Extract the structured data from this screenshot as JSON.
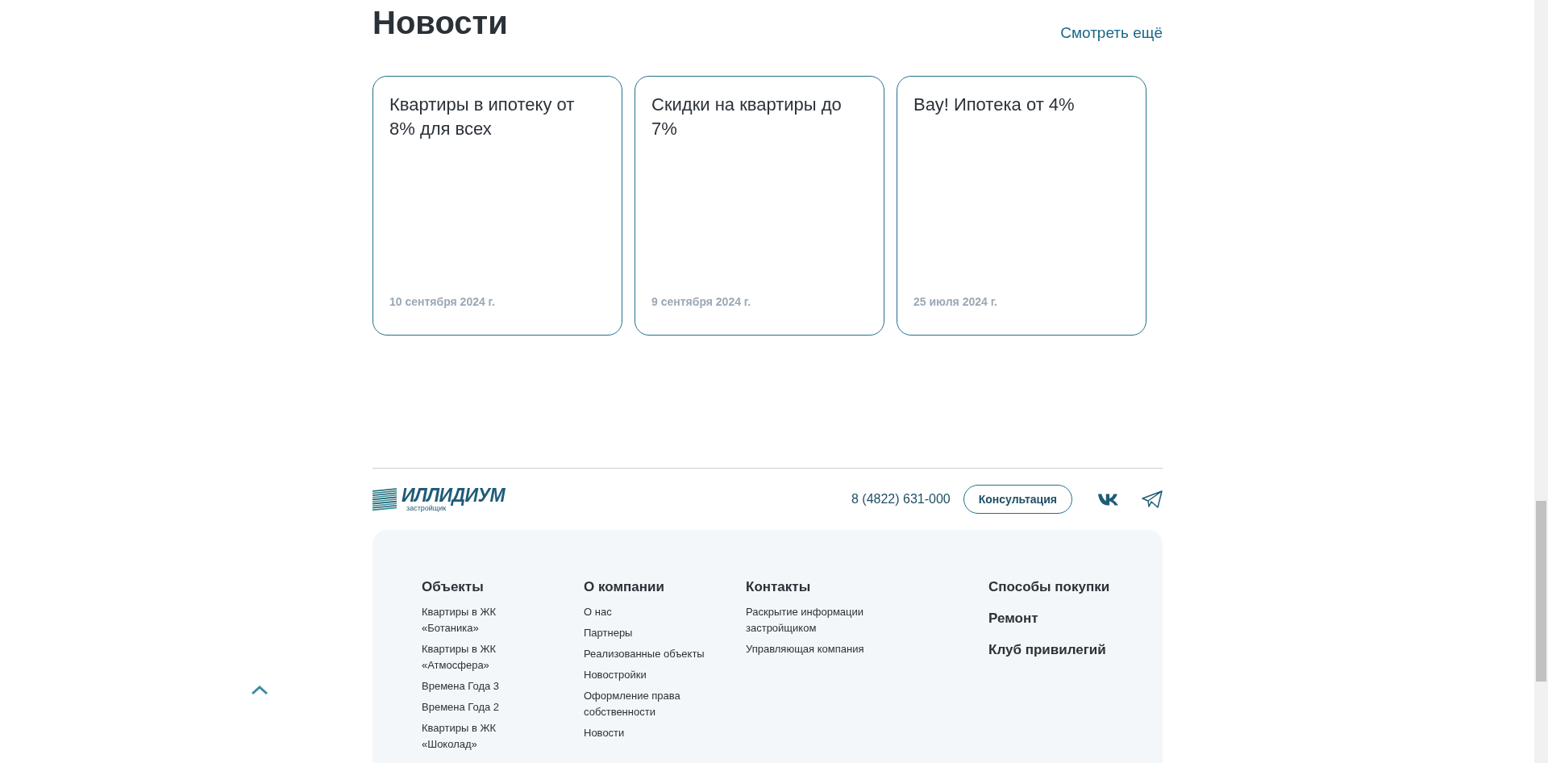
{
  "news": {
    "title": "Новости",
    "more_link": "Смотреть ещё",
    "cards": [
      {
        "title": "Квартиры в ипотеку от 8% для всех",
        "date": "10 сентября 2024 г."
      },
      {
        "title": "Скидки на квартиры до 7%",
        "date": "9 сентября 2024 г."
      },
      {
        "title": "Вау! Ипотека от 4%",
        "date": "25 июля 2024 г."
      }
    ]
  },
  "footer": {
    "logo": {
      "name": "ИЛЛИДИУМ",
      "subtitle": "застройщик"
    },
    "phone": "8 (4822) 631-000",
    "consult_button": "Консультация",
    "columns": [
      {
        "heading": "Объекты",
        "links": [
          "Квартиры в ЖК «Ботаника»",
          "Квартиры в ЖК «Атмосфера»",
          "Времена Года 3",
          "Времена Года 2",
          "Квартиры в ЖК «Шоколад»"
        ]
      },
      {
        "heading": "О компании",
        "links": [
          "О нас",
          "Партнеры",
          "Реализованные объекты",
          "Новостройки",
          "Оформление права собственности",
          "Новости"
        ]
      },
      {
        "heading": "Контакты",
        "links": [
          "Раскрытие информации застройщиком",
          "Управляющая компания"
        ]
      }
    ],
    "main_links": [
      "Способы покупки",
      "Ремонт",
      "Клуб привилегий"
    ]
  }
}
